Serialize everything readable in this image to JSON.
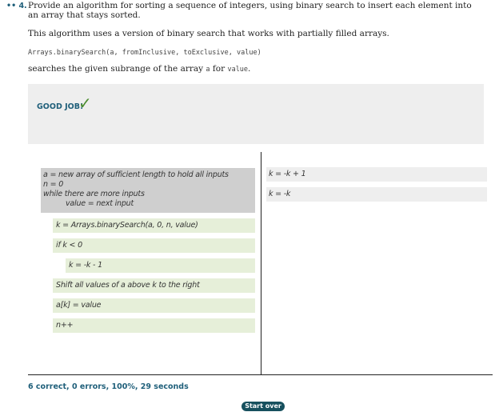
{
  "question": {
    "number": "•• 4.",
    "text": "Provide an algorithm for sorting a sequence of integers, using binary search to insert each element into an array that stays sorted.",
    "description": "This algorithm uses a version of binary search that works with partially filled arrays.",
    "signature": "Arrays.binarySearch(a, fromInclusive, toExclusive, value)",
    "desc2_prefix": "searches the given subrange of the array ",
    "desc2_a": "a",
    "desc2_mid": " for ",
    "desc2_value": "value",
    "desc2_suffix": "."
  },
  "feedback": {
    "good_job": "GOOD JOB!",
    "check_mark": "✓"
  },
  "fixed_code": [
    "a = new array of sufficient length to hold all inputs",
    "n = 0",
    "while there are more inputs",
    "value = next input"
  ],
  "answer_tiles": [
    "k = Arrays.binarySearch(a, 0, n, value)",
    "if k < 0",
    "k = -k - 1",
    "Shift all values of a above k to the right",
    "a[k] = value",
    "n++"
  ],
  "distractor_tiles": [
    "k = -k + 1",
    "k = -k"
  ],
  "status": {
    "score": "6 correct, 0 errors, 100%, 29 seconds"
  },
  "buttons": {
    "start_over": "Start over"
  },
  "colors": {
    "accent": "#1f5f7a",
    "check": "#4c8c2f",
    "tile_green": "#e6efd9",
    "tile_gray": "#eeeeee",
    "fixed_gray": "#cfcfcf",
    "button": "#17505e"
  }
}
